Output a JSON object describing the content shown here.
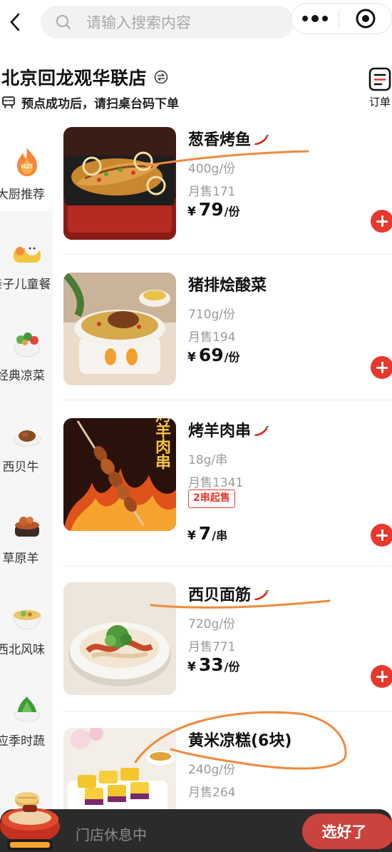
{
  "search": {
    "placeholder": "请输入搜索内容"
  },
  "store": {
    "name": "北京回龙观华联店",
    "notice": "预点成功后，请扫桌台码下单",
    "orders_label": "订单"
  },
  "categories": [
    {
      "label": "大厨推荐",
      "badge": "HOT",
      "icon": "flame-icon",
      "selected": true
    },
    {
      "label": "亲子儿童餐",
      "icon": "kids-meal-icon"
    },
    {
      "label": "经典凉菜",
      "icon": "salad-bowl-icon"
    },
    {
      "label": "西贝牛",
      "icon": "beef-dish-icon"
    },
    {
      "label": "草原羊",
      "icon": "lamb-pot-icon"
    },
    {
      "label": "西北风味",
      "icon": "noodle-bowl-icon"
    },
    {
      "label": "应季时蔬",
      "icon": "vegetable-bowl-icon"
    }
  ],
  "dishes": [
    {
      "name": "葱香烤鱼",
      "spicy": true,
      "weight": "400g/份",
      "sales": "月售171",
      "price": "79",
      "unit": "/份",
      "tag": ""
    },
    {
      "name": "猪排烩酸菜",
      "spicy": false,
      "weight": "710g/份",
      "sales": "月售194",
      "price": "69",
      "unit": "/份",
      "tag": ""
    },
    {
      "name": "烤羊肉串",
      "spicy": true,
      "weight": "18g/串",
      "sales": "月售1341",
      "price": "7",
      "unit": "/串",
      "tag": "2串起售",
      "image_text": "烤羊肉串"
    },
    {
      "name": "西贝面筋",
      "spicy": true,
      "weight": "720g/份",
      "sales": "月售771",
      "price": "33",
      "unit": "/份",
      "tag": ""
    },
    {
      "name": "黄米凉糕(6块)",
      "spicy": false,
      "weight": "240g/份",
      "sales": "月售264",
      "price": "",
      "unit": "",
      "tag": ""
    }
  ],
  "currency_symbol": "¥",
  "cart": {
    "status": "门店休息中",
    "checkout_label": "选好了"
  },
  "colors": {
    "accent": "#e8372c",
    "cart_bar": "#2b2b2b",
    "annotation_marker": "#f08a3c"
  }
}
